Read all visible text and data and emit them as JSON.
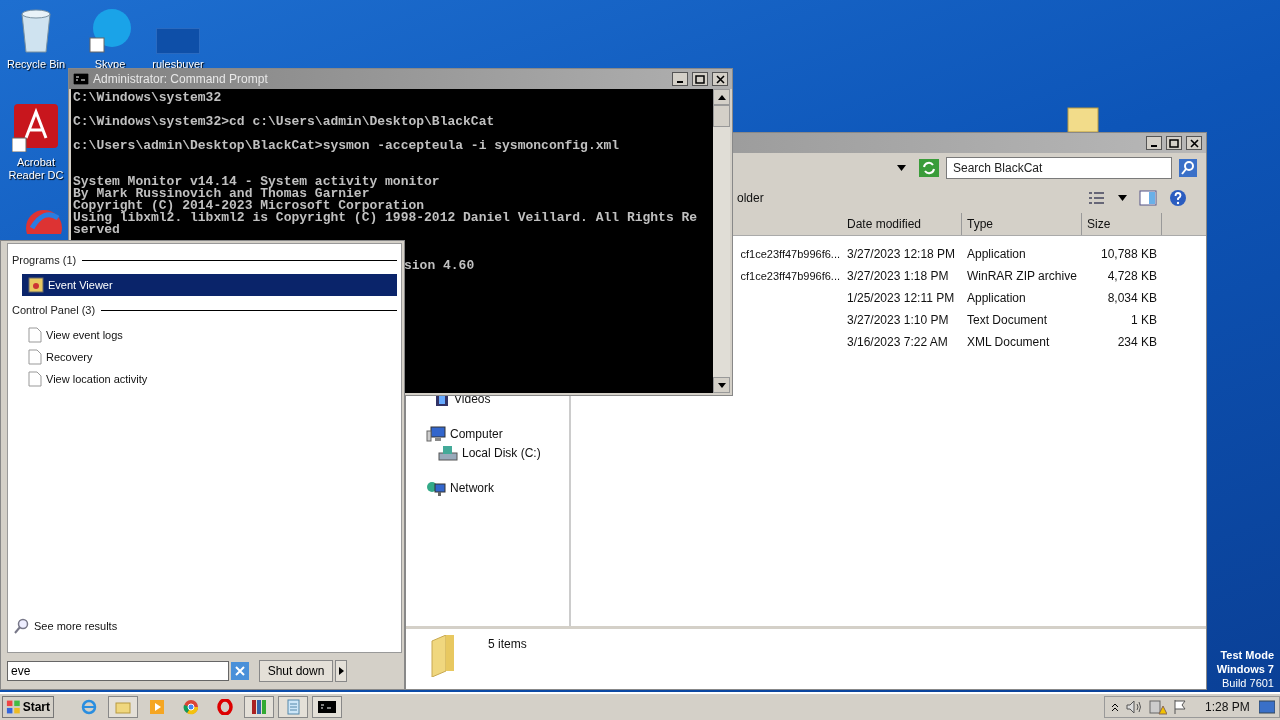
{
  "desktop": {
    "icons": [
      {
        "label": "Recycle Bin",
        "kind": "bin"
      },
      {
        "label": "Skype",
        "kind": "skype"
      },
      {
        "label": "rulesbuyer",
        "kind": "blank"
      },
      {
        "label": "Acrobat Reader DC",
        "kind": "acrobat"
      }
    ],
    "notice": [
      "Test Mode",
      "Windows 7",
      "Build 7601"
    ]
  },
  "explorer": {
    "search": {
      "placeholder": "Search BlackCat"
    },
    "toolbar_text": "older",
    "columns": [
      "Date modified",
      "Type",
      "Size"
    ],
    "rows": [
      {
        "name": "cf1ce23ff47b996f6...",
        "date": "3/27/2023 12:18 PM",
        "type": "Application",
        "size": "10,788 KB"
      },
      {
        "name": "cf1ce23ff47b996f6...",
        "date": "3/27/2023 1:18 PM",
        "type": "WinRAR ZIP archive",
        "size": "4,728 KB"
      },
      {
        "date": "1/25/2023 12:11 PM",
        "type": "Application",
        "size": "8,034 KB"
      },
      {
        "date": "3/27/2023 1:10 PM",
        "type": "Text Document",
        "size": "1 KB"
      },
      {
        "date": "3/16/2023 7:22 AM",
        "type": "XML Document",
        "size": "234 KB"
      }
    ],
    "nav": [
      {
        "label": "Videos",
        "kind": "videos"
      },
      {
        "label": "Computer",
        "kind": "computer",
        "children": [
          {
            "label": "Local Disk (C:)",
            "kind": "disk"
          }
        ]
      },
      {
        "label": "Network",
        "kind": "network"
      }
    ],
    "status": "5 items"
  },
  "command_prompt": {
    "title": "Administrator: Command Prompt",
    "blocks": [
      {
        "kind": "prompt",
        "lines": [
          "C:\\Windows\\system32"
        ]
      },
      {
        "kind": "prompt",
        "lines": [
          "C:\\Windows\\system32>cd c:\\Users\\admin\\Desktop\\BlackCat"
        ]
      },
      {
        "kind": "prompt",
        "lines": [
          "c:\\Users\\admin\\Desktop\\BlackCat>sysmon -accepteula -i sysmonconfig.xml"
        ]
      },
      {
        "kind": "output",
        "lines": [
          "System Monitor v14.14 - System activity monitor",
          "By Mark Russinovich and Thomas Garnier",
          "Copyright (C) 2014-2023 Microsoft Corporation",
          "Using libxml2. libxml2 is Copyright (C) 1998-2012 Daniel Veillard. All Rights Re",
          "served"
        ]
      },
      {
        "kind": "partial",
        "lines": [
          "sion 4.60"
        ]
      }
    ]
  },
  "start_menu": {
    "groups": [
      {
        "title": "Programs (1)",
        "items": [
          {
            "label": "Event Viewer",
            "kind": "program",
            "selected": true
          }
        ]
      },
      {
        "title": "Control Panel (3)",
        "items": [
          {
            "label": "View event logs",
            "kind": "page",
            "selected": false
          },
          {
            "label": "Recovery",
            "kind": "page",
            "selected": false
          },
          {
            "label": "View location activity",
            "kind": "page",
            "selected": false
          }
        ]
      }
    ],
    "see_more": "See more results",
    "search": {
      "value": "eve"
    },
    "shutdown": "Shut down"
  },
  "taskbar": {
    "start": "Start",
    "clock": "1:28 PM"
  }
}
